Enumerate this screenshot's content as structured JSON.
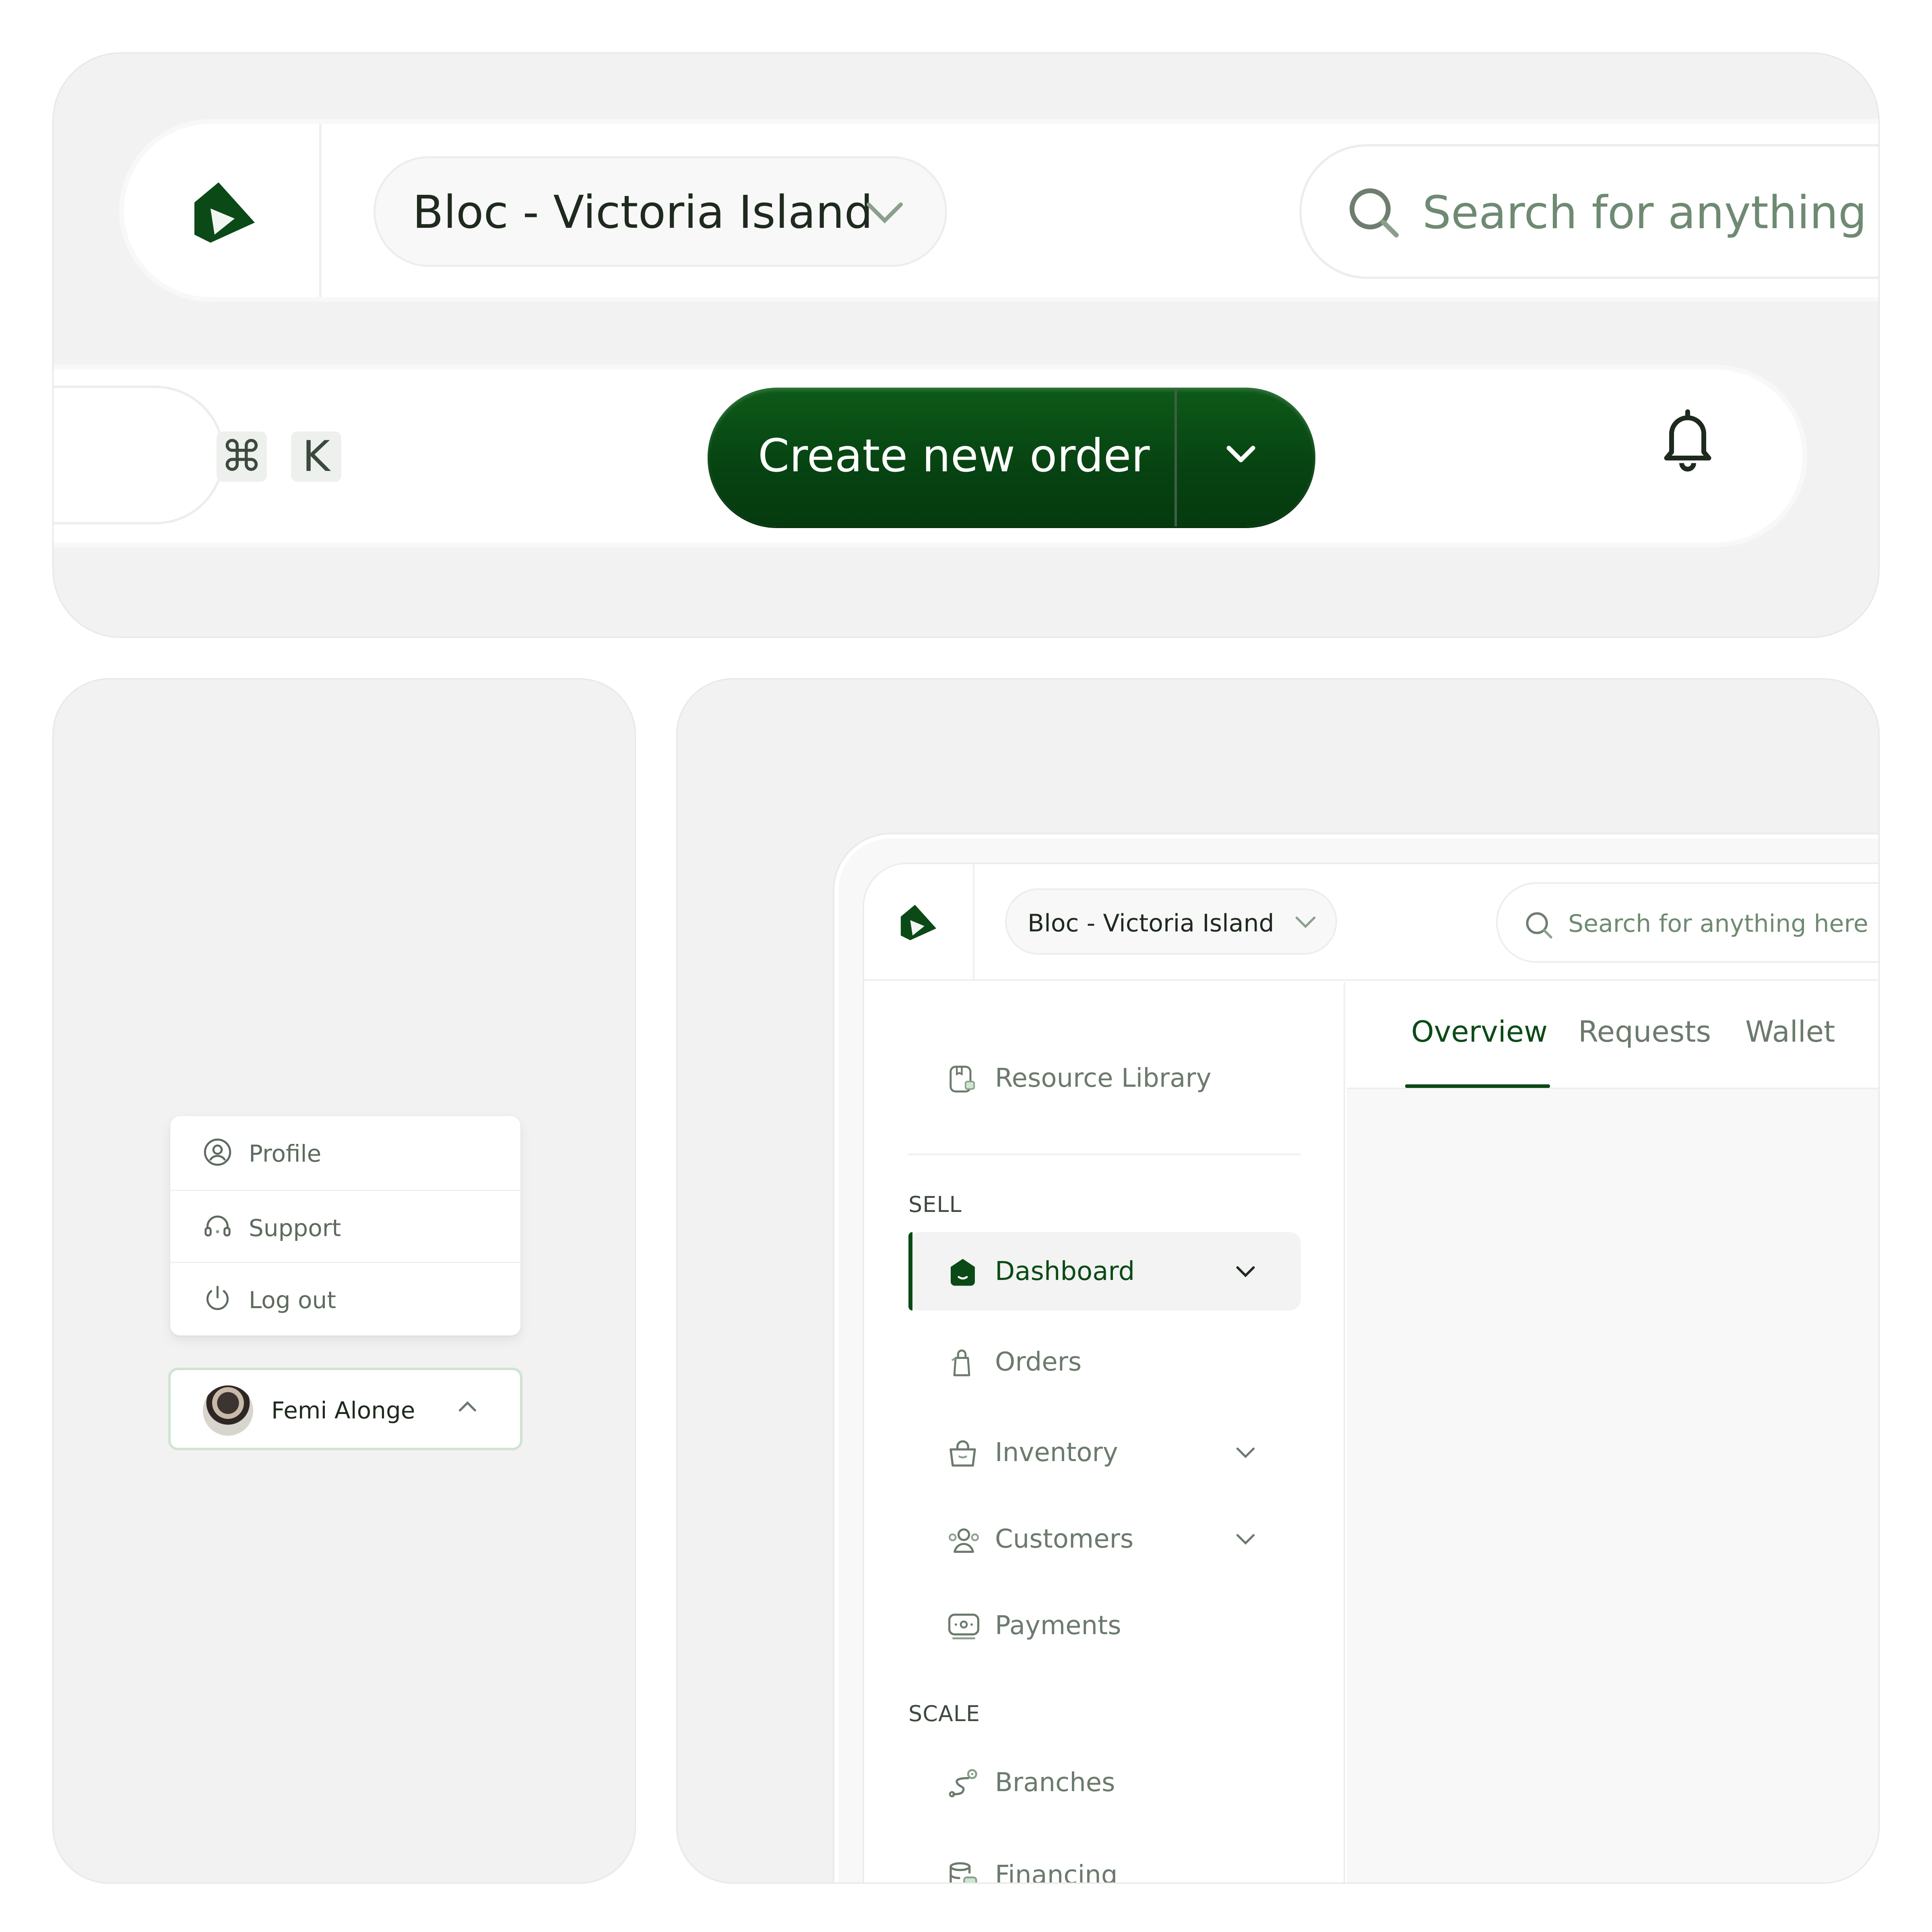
{
  "colors": {
    "brand_green": "#0b4a16",
    "muted_text": "#6b7a6c",
    "card_bg": "#f1f2f1",
    "panel_bg": "#ffffff"
  },
  "header_large": {
    "location": "Bloc - Victoria Island",
    "search_placeholder": "Search for anything here",
    "shortcut_keys": [
      "⌘",
      "K"
    ],
    "create_button": "Create new order",
    "icons": [
      "logo-icon",
      "chevron-down-icon",
      "search-icon",
      "bell-icon"
    ]
  },
  "user_menu": {
    "items": [
      {
        "label": "Profile",
        "icon": "user-circle-icon"
      },
      {
        "label": "Support",
        "icon": "headset-icon"
      },
      {
        "label": "Log out",
        "icon": "power-icon"
      }
    ],
    "user_name": "Femi Alonge"
  },
  "app": {
    "location": "Bloc - Victoria Island",
    "search_placeholder": "Search for anything here",
    "tabs": [
      {
        "label": "Overview",
        "active": true
      },
      {
        "label": "Requests",
        "active": false
      },
      {
        "label": "Wallet",
        "active": false
      }
    ],
    "sidebar": {
      "resource_library": "Resource Library",
      "sell_label": "SELL",
      "scale_label": "SCALE",
      "sell_items": [
        {
          "label": "Dashboard",
          "active": true,
          "expandable": true,
          "icon": "home-icon"
        },
        {
          "label": "Orders",
          "active": false,
          "expandable": false,
          "icon": "bag-icon"
        },
        {
          "label": "Inventory",
          "active": false,
          "expandable": true,
          "icon": "shopping-bag-icon"
        },
        {
          "label": "Customers",
          "active": false,
          "expandable": true,
          "icon": "users-icon"
        },
        {
          "label": "Payments",
          "active": false,
          "expandable": false,
          "icon": "payments-icon"
        }
      ],
      "scale_items": [
        {
          "label": "Branches",
          "icon": "branches-icon"
        },
        {
          "label": "Financing",
          "icon": "financing-icon"
        }
      ]
    }
  }
}
